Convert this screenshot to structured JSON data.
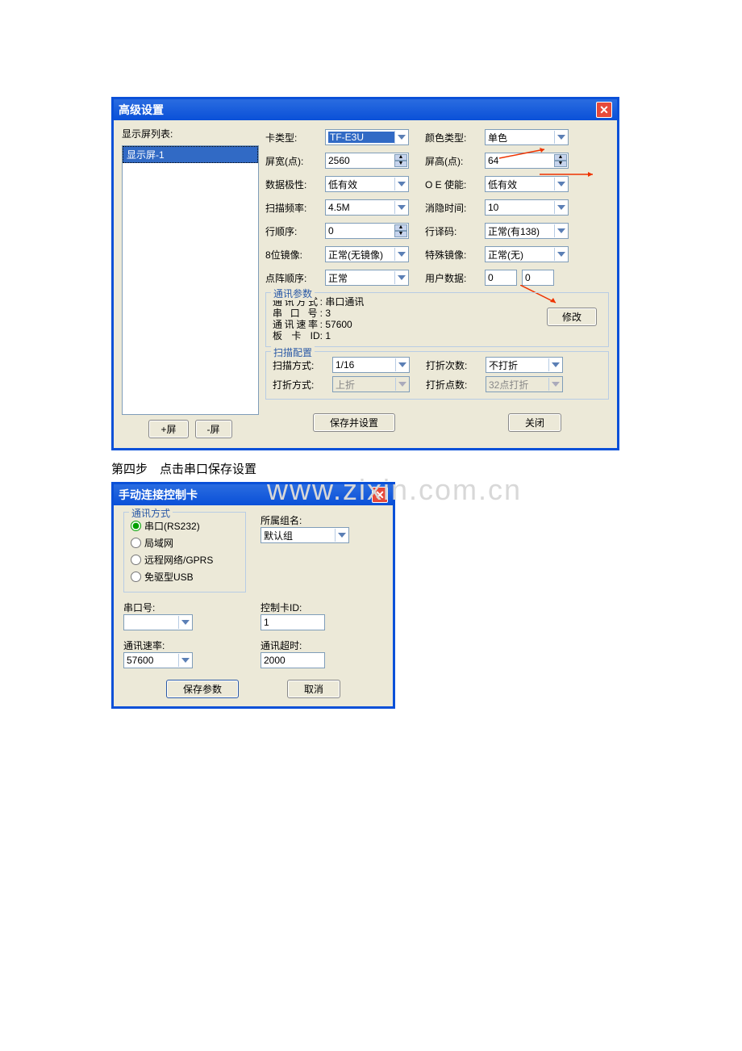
{
  "win1": {
    "title": "高级设置",
    "left": {
      "list_label": "显示屏列表:",
      "item": "显示屏-1",
      "add_btn": "+屏",
      "del_btn": "-屏"
    },
    "fields": {
      "card_type_lab": "卡类型:",
      "card_type_val": "TF-E3U",
      "color_type_lab": "颜色类型:",
      "color_type_val": "单色",
      "width_lab": "屏宽(点):",
      "width_val": "2560",
      "height_lab": "屏高(点):",
      "height_val": "64",
      "polarity_lab": "数据极性:",
      "polarity_val": "低有效",
      "oe_lab": "O E 使能:",
      "oe_val": "低有效",
      "freq_lab": "扫描频率:",
      "freq_val": "4.5M",
      "blank_lab": "消隐时间:",
      "blank_val": "10",
      "lineord_lab": "行顺序:",
      "lineord_val": "0",
      "decode_lab": "行译码:",
      "decode_val": "正常(有138)",
      "mirror8_lab": "8位镜像:",
      "mirror8_val": "正常(无镜像)",
      "specmirror_lab": "特殊镜像:",
      "specmirror_val": "正常(无)",
      "dotord_lab": "点阵顺序:",
      "dotord_val": "正常",
      "userdata_lab": "用户数据:",
      "userdata_v1": "0",
      "userdata_v2": "0"
    },
    "comm": {
      "title": "通讯参数",
      "mode_lab": "通讯方式:",
      "mode_val": "串口通讯",
      "port_lab": "串 口 号:",
      "port_val": "3",
      "rate_lab": "通讯速率:",
      "rate_val": "57600",
      "card_lab": "板 卡 ID:",
      "card_val": "1",
      "modify_btn": "修改"
    },
    "scan": {
      "title": "扫描配置",
      "scantype_lab": "扫描方式:",
      "scantype_val": "1/16",
      "foldcount_lab": "打折次数:",
      "foldcount_val": "不打折",
      "foldtype_lab": "打折方式:",
      "foldtype_val": "上折",
      "folddots_lab": "打折点数:",
      "folddots_val": "32点打折"
    },
    "save_btn": "保存并设置",
    "close_btn": "关闭"
  },
  "step_text": "第四步　点击串口保存设置",
  "win2": {
    "title": "手动连接控制卡",
    "comm_title": "通讯方式",
    "opt_serial": "串口(RS232)",
    "opt_lan": "局域网",
    "opt_remote": "远程网络/GPRS",
    "opt_usb": "免驱型USB",
    "group_lab": "所属组名:",
    "group_val": "默认组",
    "port_lab": "串口号:",
    "port_val": "",
    "ctrlid_lab": "控制卡ID:",
    "ctrlid_val": "1",
    "rate_lab": "通讯速率:",
    "rate_val": "57600",
    "timeout_lab": "通讯超时:",
    "timeout_val": "2000",
    "save_btn": "保存参数",
    "cancel_btn": "取消"
  },
  "watermark": "www.zixin.com.cn"
}
